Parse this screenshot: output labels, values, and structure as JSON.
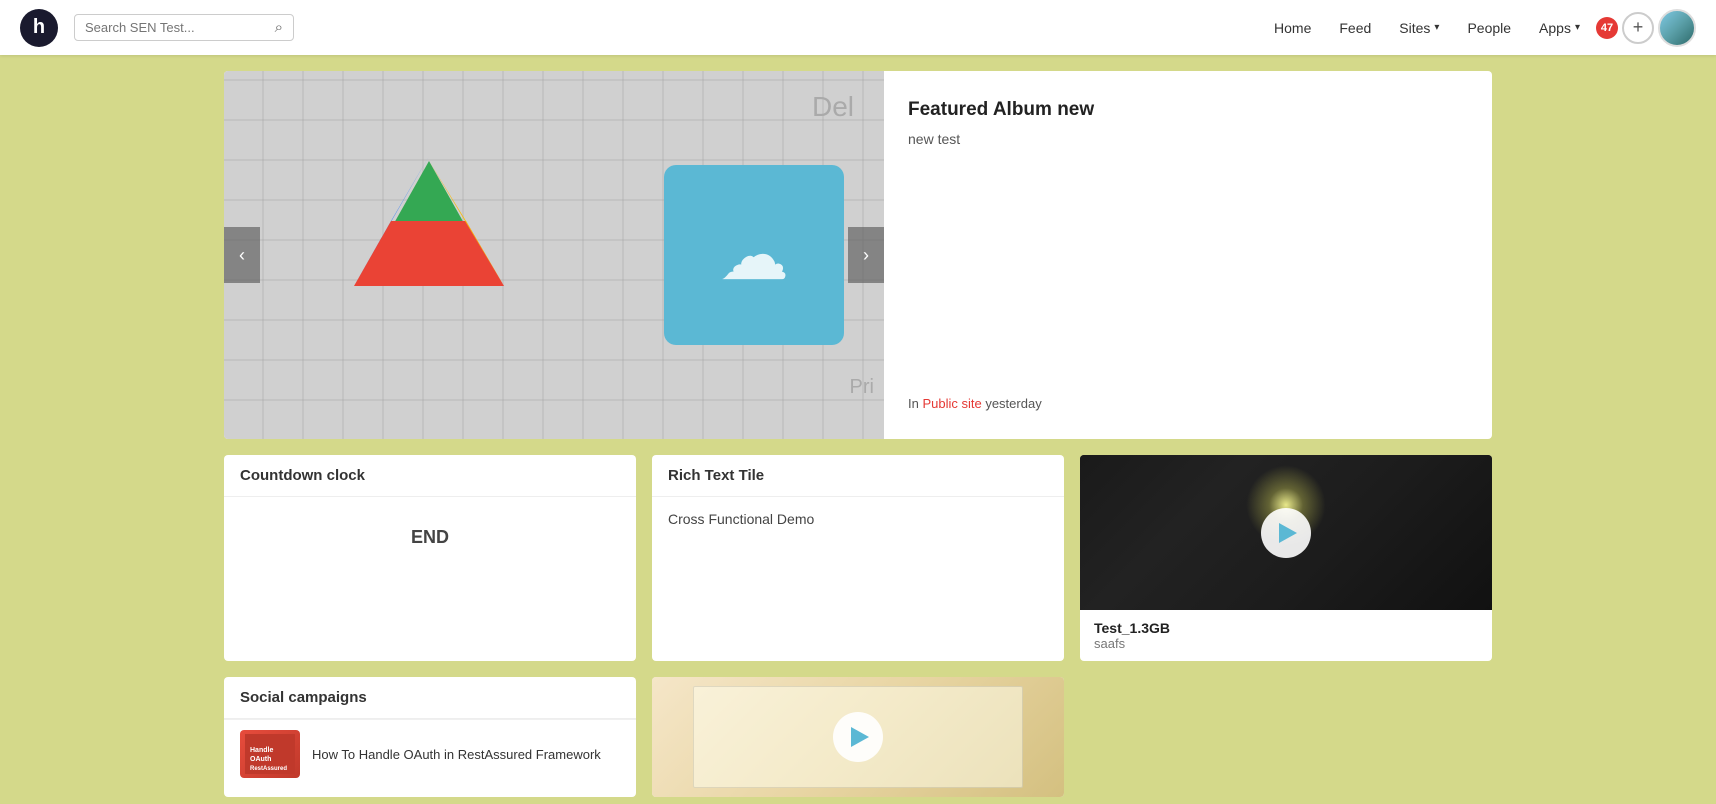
{
  "header": {
    "logo_letter": "h",
    "search_placeholder": "Search SEN Test...",
    "nav_items": [
      {
        "label": "Home",
        "has_dropdown": false
      },
      {
        "label": "Feed",
        "has_dropdown": false
      },
      {
        "label": "Sites",
        "has_dropdown": true
      },
      {
        "label": "People",
        "has_dropdown": false
      },
      {
        "label": "Apps",
        "has_dropdown": true
      }
    ],
    "notification_count": "47"
  },
  "hero": {
    "title": "Featured Album new",
    "subtitle": "new test",
    "footer_prefix": "In ",
    "footer_link": "Public site",
    "footer_suffix": " yesterday"
  },
  "countdown": {
    "header": "Countdown clock",
    "value": "END"
  },
  "rich_text": {
    "header": "Rich Text Tile",
    "body": "Cross Functional Demo"
  },
  "video": {
    "title": "Test_1.3GB",
    "subtitle": "saafs"
  },
  "social": {
    "header": "Social campaigns",
    "item": {
      "title": "How To Handle OAuth in RestAssured Framework",
      "thumbnail_text": "RestAssured"
    }
  }
}
